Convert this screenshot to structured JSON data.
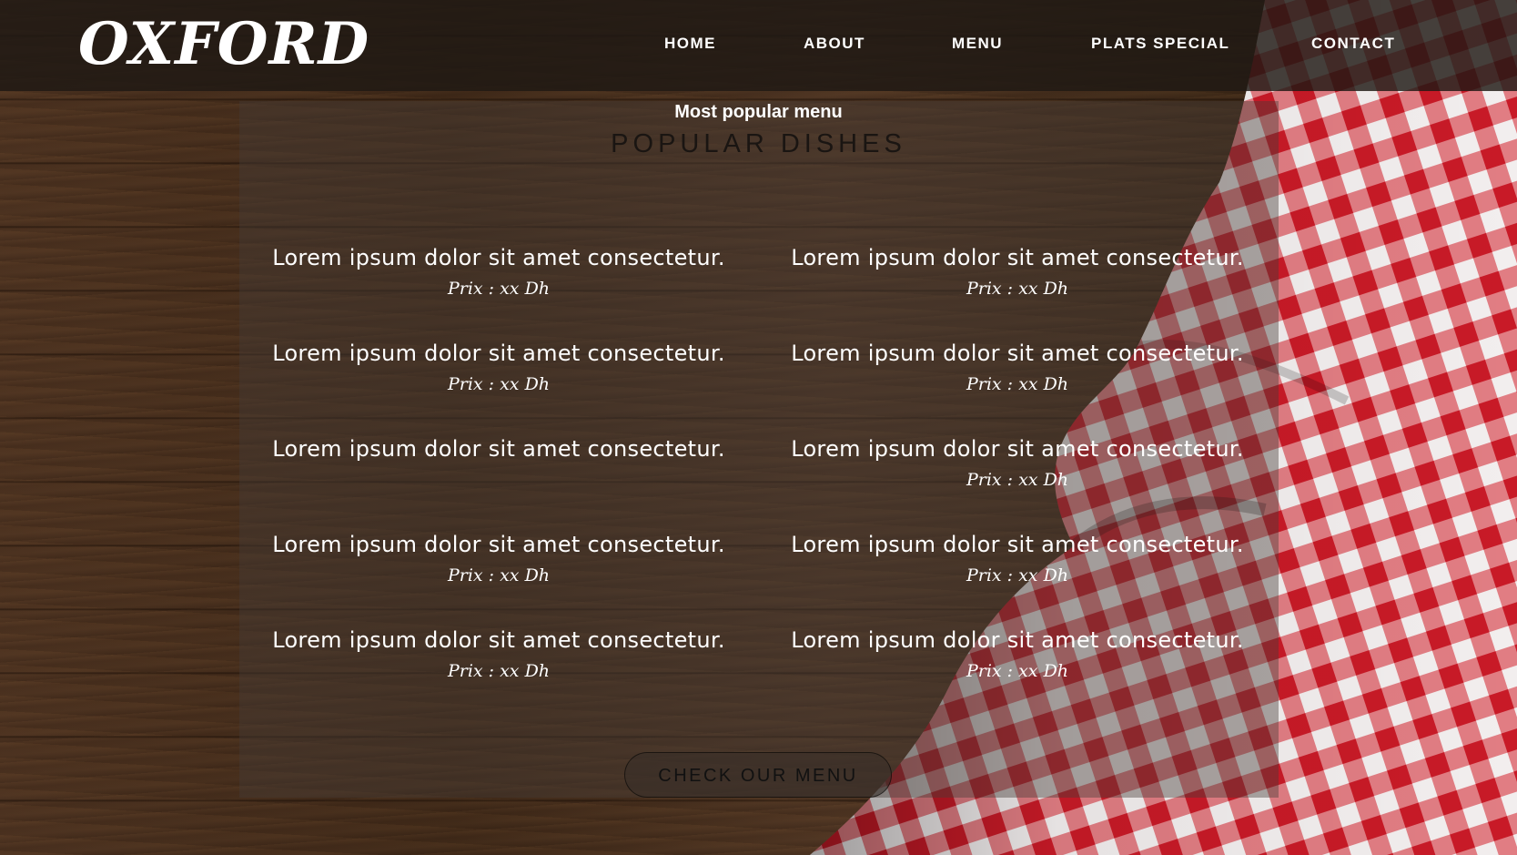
{
  "brand": {
    "logo_text": "OXFORD"
  },
  "nav": {
    "home": "HOME",
    "about": "ABOUT",
    "menu": "MENU",
    "plats_special": "PLATS SPECIAL",
    "contact": "CONTACT"
  },
  "popular": {
    "eyebrow": "Most popular menu",
    "title": "POPULAR DISHES",
    "left_column": [
      {
        "name": "Lorem ipsum dolor sit amet consectetur.",
        "price": "Prix : xx Dh"
      },
      {
        "name": "Lorem ipsum dolor sit amet consectetur.",
        "price": "Prix : xx Dh"
      },
      {
        "name": "Lorem ipsum dolor sit amet consectetur.",
        "price": ""
      },
      {
        "name": "Lorem ipsum dolor sit amet consectetur.",
        "price": "Prix : xx Dh"
      },
      {
        "name": "Lorem ipsum dolor sit amet consectetur.",
        "price": "Prix : xx Dh"
      }
    ],
    "right_column": [
      {
        "name": "Lorem ipsum dolor sit amet consectetur.",
        "price": "Prix : xx Dh"
      },
      {
        "name": "Lorem ipsum dolor sit amet consectetur.",
        "price": "Prix : xx Dh"
      },
      {
        "name": "Lorem ipsum dolor sit amet consectetur.",
        "price": "Prix : xx Dh"
      },
      {
        "name": "Lorem ipsum dolor sit amet consectetur.",
        "price": "Prix : xx Dh"
      },
      {
        "name": "Lorem ipsum dolor sit amet consectetur.",
        "price": "Prix : xx Dh"
      }
    ],
    "cta_label": "CHECK OUR MENU"
  },
  "colors": {
    "cloth_red": "#d3202c",
    "cloth_white": "#f2eeee",
    "wood": "#3d2818"
  }
}
